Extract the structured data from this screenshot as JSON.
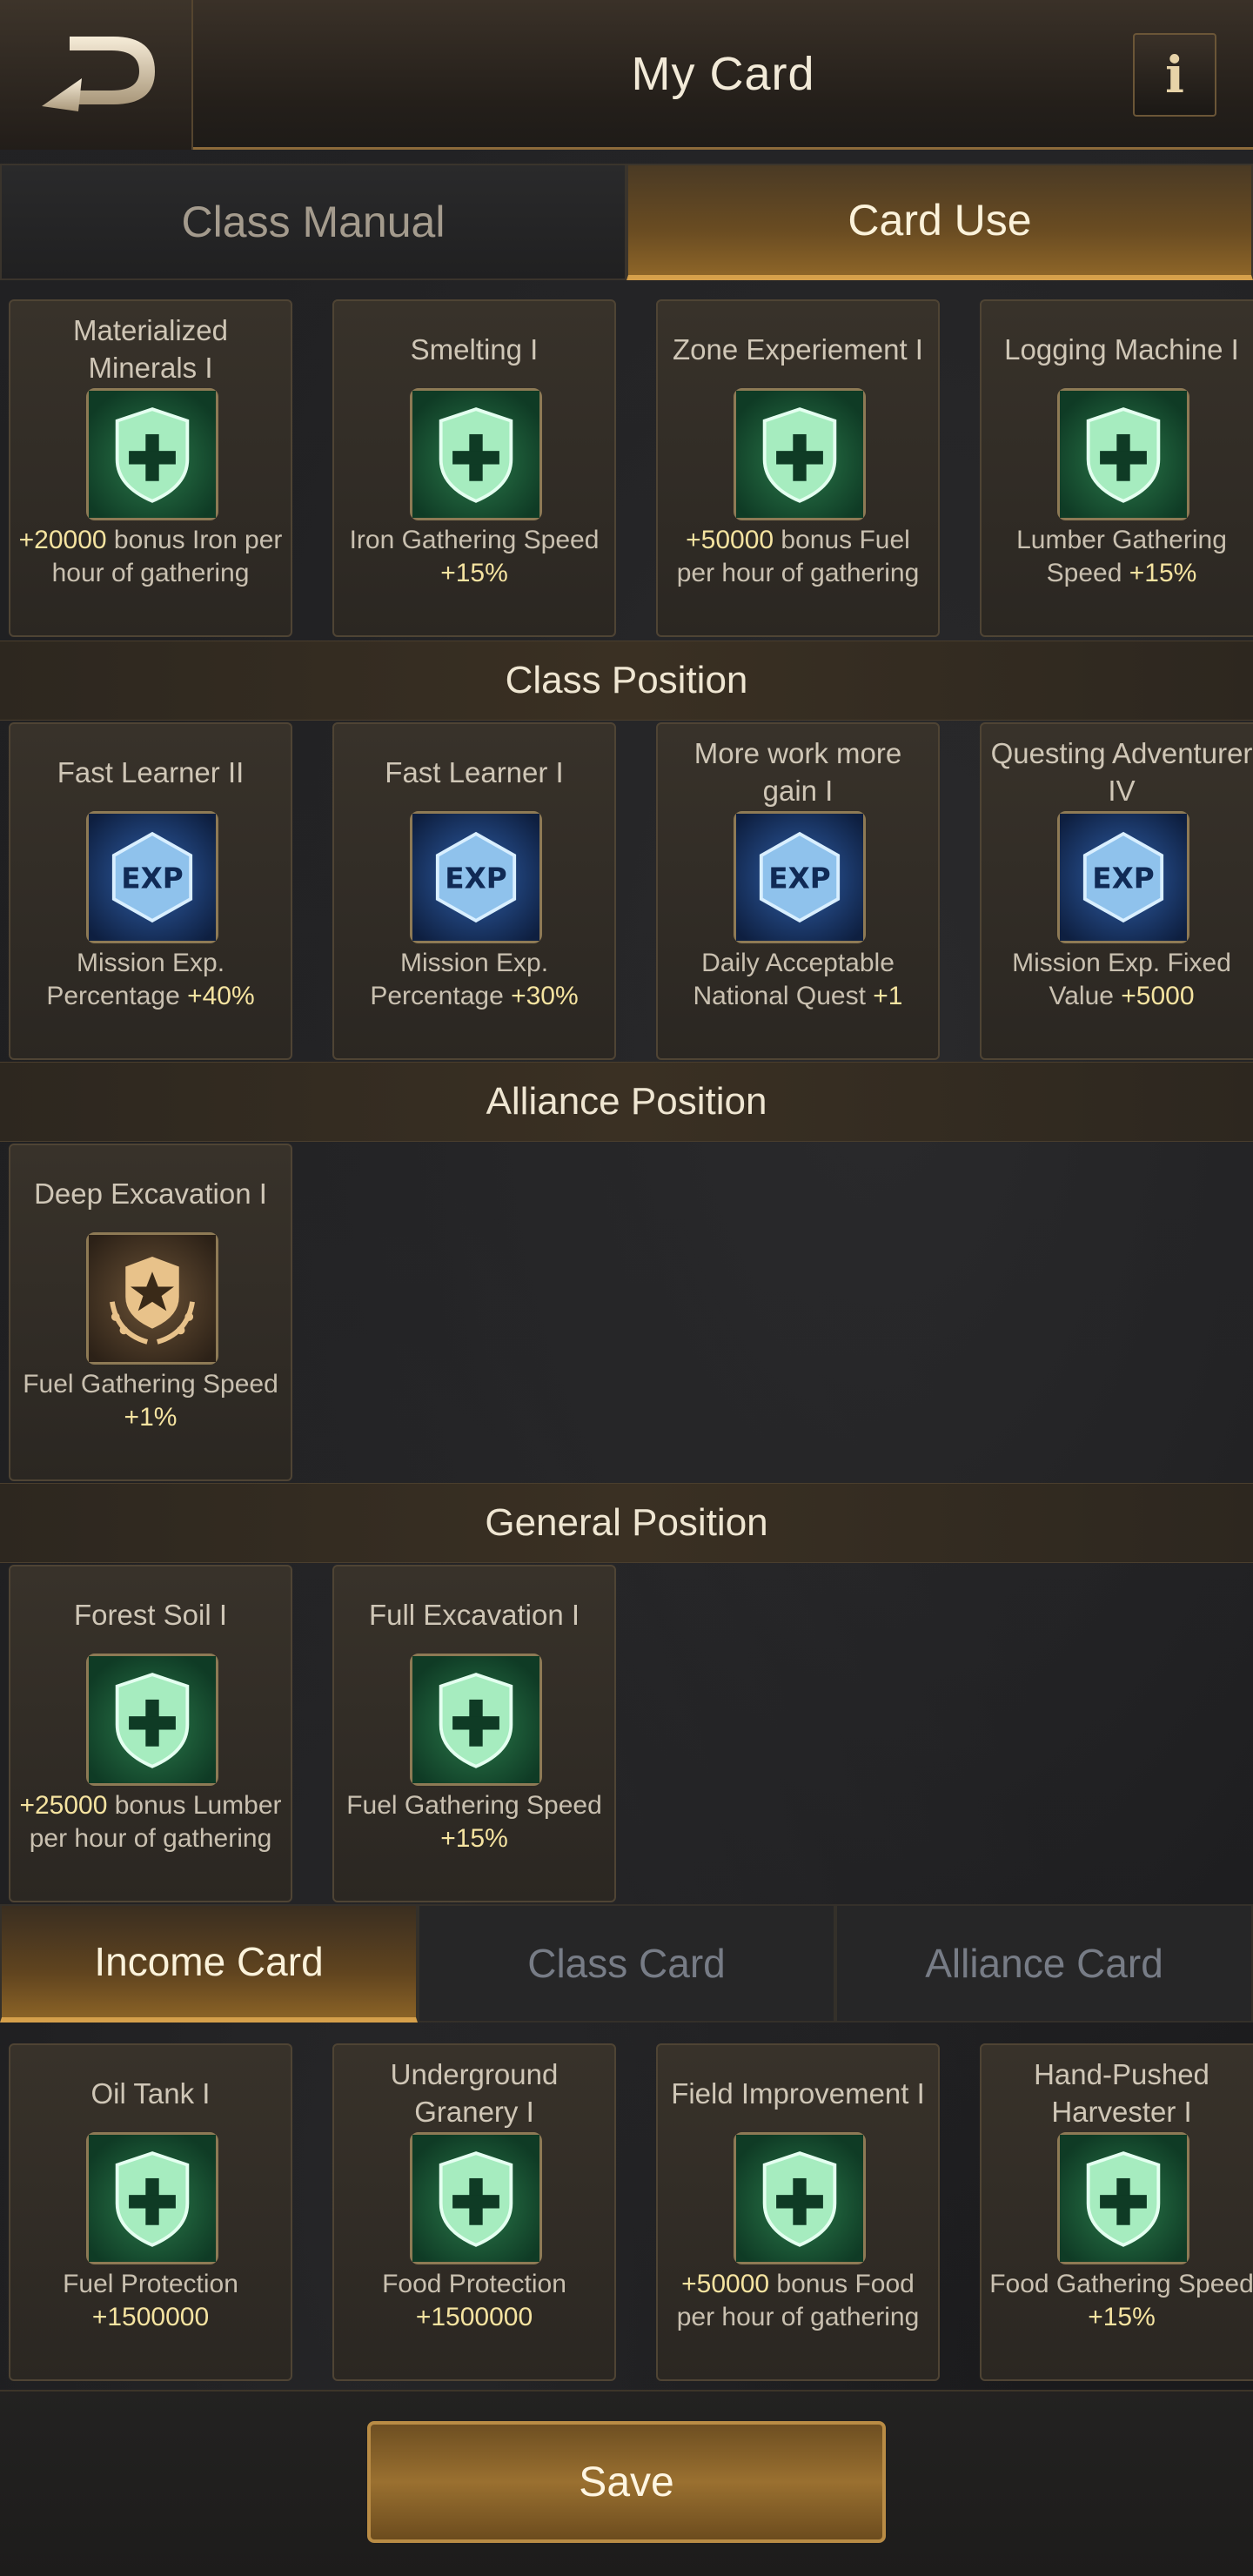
{
  "header": {
    "title": "My Card",
    "info_label": "i"
  },
  "top_tabs": [
    {
      "label": "Class Manual",
      "active": false
    },
    {
      "label": "Card Use",
      "active": true
    }
  ],
  "sections": [
    {
      "title": "",
      "cards": [
        {
          "name": "Materialized Minerals I",
          "icon": "green-shield-plus-icon",
          "desc_pre": "",
          "desc_hl": "+20000",
          "desc_post": " bonus Iron per hour of gathering"
        },
        {
          "name": "Smelting I",
          "icon": "green-shield-plus-icon",
          "desc_pre": "Iron Gathering Speed ",
          "desc_hl": "+15%",
          "desc_post": ""
        },
        {
          "name": "Zone Experiement I",
          "icon": "green-shield-plus-icon",
          "desc_pre": "",
          "desc_hl": "+50000",
          "desc_post": " bonus Fuel per hour of gathering"
        },
        {
          "name": "Logging Machine I",
          "icon": "green-shield-plus-icon",
          "desc_pre": "Lumber Gathering Speed ",
          "desc_hl": "+15%",
          "desc_post": ""
        }
      ]
    },
    {
      "title": "Class Position",
      "cards": [
        {
          "name": "Fast Learner II",
          "icon": "exp-icon",
          "desc_pre": "Mission Exp. Percentage ",
          "desc_hl": "+40%",
          "desc_post": ""
        },
        {
          "name": "Fast Learner I",
          "icon": "exp-icon",
          "desc_pre": "Mission Exp. Percentage ",
          "desc_hl": "+30%",
          "desc_post": ""
        },
        {
          "name": "More work more gain I",
          "icon": "exp-icon",
          "desc_pre": "Daily Acceptable National Quest ",
          "desc_hl": "+1",
          "desc_post": ""
        },
        {
          "name": "Questing Adventurer IV",
          "icon": "exp-icon",
          "desc_pre": "Mission Exp. Fixed Value ",
          "desc_hl": "+5000",
          "desc_post": ""
        }
      ]
    },
    {
      "title": "Alliance Position",
      "cards": [
        {
          "name": "Deep Excavation I",
          "icon": "laurel-star-shield-icon",
          "desc_pre": "Fuel Gathering Speed ",
          "desc_hl": "+1%",
          "desc_post": ""
        }
      ]
    },
    {
      "title": "General Position",
      "cards": [
        {
          "name": "Forest Soil I",
          "icon": "green-shield-plus-icon",
          "desc_pre": "",
          "desc_hl": "+25000",
          "desc_post": " bonus Lumber per hour of gathering"
        },
        {
          "name": "Full Excavation I",
          "icon": "green-shield-plus-icon",
          "desc_pre": "Fuel Gathering Speed ",
          "desc_hl": "+15%",
          "desc_post": ""
        }
      ]
    }
  ],
  "bottom_tabs": [
    {
      "label": "Income Card",
      "active": true
    },
    {
      "label": "Class Card",
      "active": false
    },
    {
      "label": "Alliance Card",
      "active": false
    }
  ],
  "income_cards": [
    {
      "name": "Oil Tank I",
      "icon": "green-shield-plus-icon",
      "desc_pre": "Fuel Protection ",
      "desc_hl": "+1500000",
      "desc_post": ""
    },
    {
      "name": "Underground Granery I",
      "icon": "green-shield-plus-icon",
      "desc_pre": "Food Protection ",
      "desc_hl": "+1500000",
      "desc_post": ""
    },
    {
      "name": "Field Improvement I",
      "icon": "green-shield-plus-icon",
      "desc_pre": "",
      "desc_hl": "+50000",
      "desc_post": " bonus Food per hour of gathering"
    },
    {
      "name": "Hand-Pushed Harvester I",
      "icon": "green-shield-plus-icon",
      "desc_pre": "Food Gathering Speed ",
      "desc_hl": "+15%",
      "desc_post": ""
    }
  ],
  "footer": {
    "save_label": "Save"
  },
  "colors": {
    "accent_gold": "#d6a04b",
    "highlight_text": "#f5e3a0",
    "green_icon": "#2f8a55",
    "exp_blue": "#2f5fa8"
  }
}
